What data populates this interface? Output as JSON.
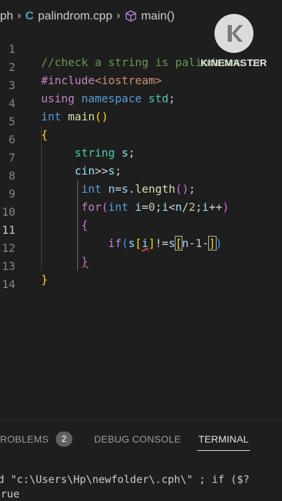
{
  "breadcrumb": {
    "folder": "ph",
    "cpp_icon": "C",
    "file": "palindrom.cpp",
    "symbol": "main()"
  },
  "editor": {
    "line_numbers": [
      "1",
      "2",
      "3",
      "4",
      "5",
      "6",
      "7",
      "8",
      "9",
      "10",
      "11",
      "12",
      "13",
      "14"
    ],
    "active_line": "11",
    "comment": "//check a string is palindrome or"
  },
  "watermark": {
    "brand": "KINEMASTER",
    "logo_letter": "K"
  },
  "panel": {
    "problems_label": "ROBLEMS",
    "problems_count": "2",
    "debug_label": "DEBUG CONSOLE",
    "terminal_label": "TERMINAL"
  },
  "terminal": {
    "line1": "cd \"c:\\Users\\Hp\\newfolder\\.cph\\\" ; if ($?",
    "line2": "true"
  },
  "colors": {
    "background": "#1e1e1e",
    "keyword": "#569cd6",
    "comment": "#6a9955",
    "type": "#4ec9b0",
    "variable": "#9cdcfe",
    "function": "#dcdcaa",
    "number": "#b5cea8"
  },
  "icons": [
    "cpp-file-icon",
    "cube-symbol-icon",
    "chevron-right-icon",
    "kinemaster-logo-icon"
  ]
}
